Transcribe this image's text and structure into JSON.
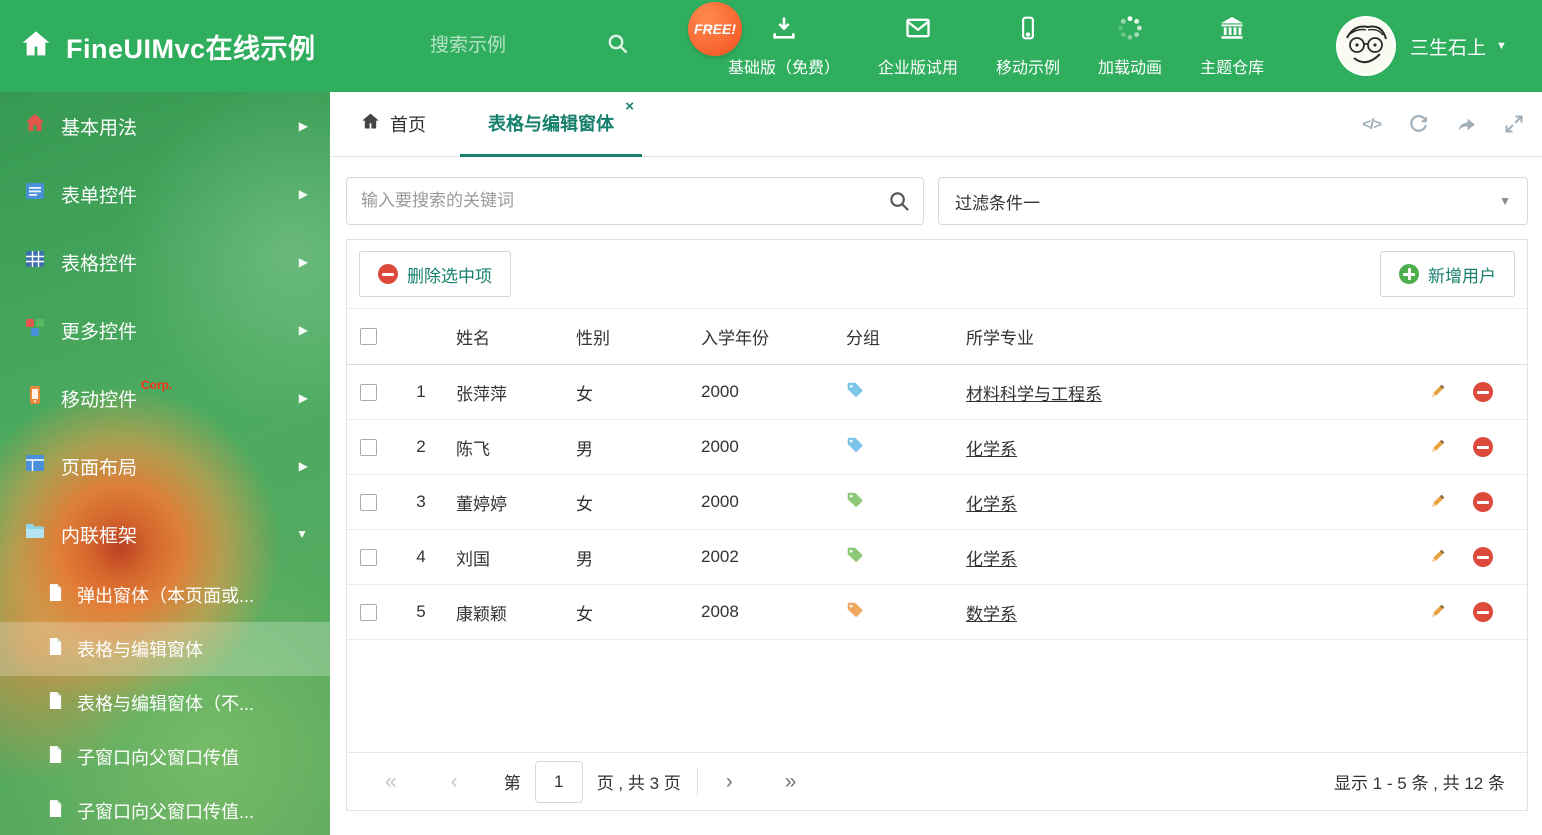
{
  "colors": {
    "header_green": "#2fae5e",
    "accent_teal": "#17806d",
    "free_badge_orange": "#f4511e",
    "delete_red": "#dd4a3c",
    "add_green": "#4cae4c"
  },
  "header": {
    "title": "FineUIMvc在线示例",
    "search_placeholder": "搜索示例",
    "free_badge": "FREE!",
    "nav": [
      {
        "label": "基础版（免费）",
        "icon": "download-icon"
      },
      {
        "label": "企业版试用",
        "icon": "envelope-icon"
      },
      {
        "label": "移动示例",
        "icon": "mobile-icon"
      },
      {
        "label": "加载动画",
        "icon": "spinner-icon"
      },
      {
        "label": "主题仓库",
        "icon": "bank-icon"
      }
    ],
    "user": "三生石上"
  },
  "sidebar": {
    "items": [
      {
        "label": "基本用法",
        "icon": "home-icon"
      },
      {
        "label": "表单控件",
        "icon": "form-icon"
      },
      {
        "label": "表格控件",
        "icon": "table-icon"
      },
      {
        "label": "更多控件",
        "icon": "blocks-icon"
      },
      {
        "label": "移动控件",
        "icon": "mobile-icon",
        "badge": "Corp."
      },
      {
        "label": "页面布局",
        "icon": "layout-icon"
      },
      {
        "label": "内联框架",
        "icon": "folder-icon",
        "expanded": true
      }
    ],
    "subitems": [
      {
        "label": "弹出窗体（本页面或..."
      },
      {
        "label": "表格与编辑窗体",
        "active": true
      },
      {
        "label": "表格与编辑窗体（不..."
      },
      {
        "label": "子窗口向父窗口传值"
      },
      {
        "label": "子窗口向父窗口传值..."
      }
    ]
  },
  "tabs": {
    "home": "首页",
    "active": "表格与编辑窗体"
  },
  "filter": {
    "search_placeholder": "输入要搜索的关键词",
    "dropdown_value": "过滤条件一"
  },
  "toolbar": {
    "delete_label": "删除选中项",
    "add_label": "新增用户"
  },
  "table": {
    "columns": [
      "姓名",
      "性别",
      "入学年份",
      "分组",
      "所学专业"
    ],
    "rows": [
      {
        "num": "1",
        "name": "张萍萍",
        "gender": "女",
        "year": "2000",
        "tag_color": "#7cc5e8",
        "major": "材料科学与工程系"
      },
      {
        "num": "2",
        "name": "陈飞",
        "gender": "男",
        "year": "2000",
        "tag_color": "#7cc5e8",
        "major": "化学系"
      },
      {
        "num": "3",
        "name": "董婷婷",
        "gender": "女",
        "year": "2000",
        "tag_color": "#8ec977",
        "major": "化学系"
      },
      {
        "num": "4",
        "name": "刘国",
        "gender": "男",
        "year": "2002",
        "tag_color": "#8ec977",
        "major": "化学系"
      },
      {
        "num": "5",
        "name": "康颖颖",
        "gender": "女",
        "year": "2008",
        "tag_color": "#f0a860",
        "major": "数学系"
      }
    ]
  },
  "pagination": {
    "prefix": "第",
    "current": "1",
    "suffix": "页 , 共 3 页",
    "summary": "显示 1 - 5 条 , 共 12 条"
  }
}
